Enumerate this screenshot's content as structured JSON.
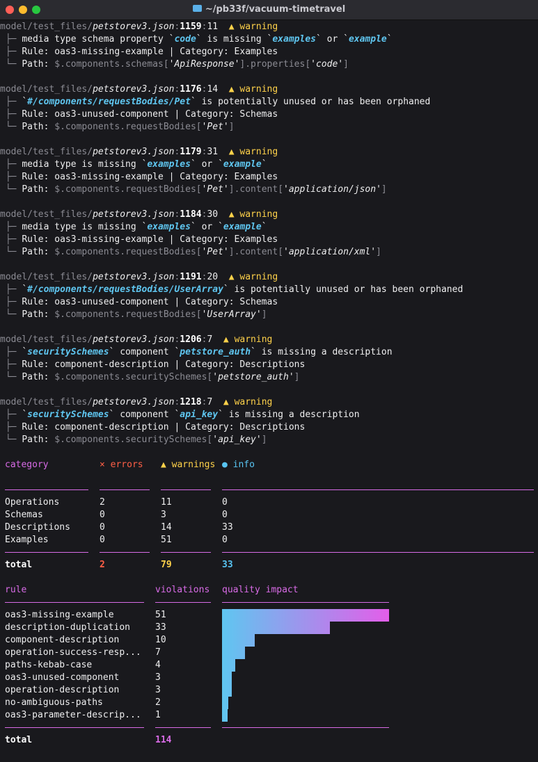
{
  "window": {
    "title": "~/pb33f/vacuum-timetravel"
  },
  "violations": [
    {
      "path_prefix": "model/test_files/",
      "file": "petstorev3.json",
      "line": "1159",
      "col": "11",
      "severity": "warning",
      "msg_parts": [
        "media type schema property `",
        "code",
        "` is missing `",
        "examples",
        "` or `",
        "example",
        "`"
      ],
      "rule_label": "Rule: oas3-missing-example | Category: Examples",
      "path_parts": [
        "$.components.schemas[",
        "'ApiResponse'",
        "].properties[",
        "'code'",
        "]"
      ]
    },
    {
      "path_prefix": "model/test_files/",
      "file": "petstorev3.json",
      "line": "1176",
      "col": "14",
      "severity": "warning",
      "msg_parts": [
        "`",
        "#/components/requestBodies/Pet",
        "` is potentially unused or has been orphaned"
      ],
      "rule_label": "Rule: oas3-unused-component | Category: Schemas",
      "path_parts": [
        "$.components.requestBodies[",
        "'Pet'",
        "]"
      ]
    },
    {
      "path_prefix": "model/test_files/",
      "file": "petstorev3.json",
      "line": "1179",
      "col": "31",
      "severity": "warning",
      "msg_parts": [
        "media type is missing `",
        "examples",
        "` or `",
        "example",
        "`"
      ],
      "rule_label": "Rule: oas3-missing-example | Category: Examples",
      "path_parts": [
        "$.components.requestBodies[",
        "'Pet'",
        "].content[",
        "'application/json'",
        "]"
      ]
    },
    {
      "path_prefix": "model/test_files/",
      "file": "petstorev3.json",
      "line": "1184",
      "col": "30",
      "severity": "warning",
      "msg_parts": [
        "media type is missing `",
        "examples",
        "` or `",
        "example",
        "`"
      ],
      "rule_label": "Rule: oas3-missing-example | Category: Examples",
      "path_parts": [
        "$.components.requestBodies[",
        "'Pet'",
        "].content[",
        "'application/xml'",
        "]"
      ]
    },
    {
      "path_prefix": "model/test_files/",
      "file": "petstorev3.json",
      "line": "1191",
      "col": "20",
      "severity": "warning",
      "msg_parts": [
        "`",
        "#/components/requestBodies/UserArray",
        "` is potentially unused or has been orphaned"
      ],
      "rule_label": "Rule: oas3-unused-component | Category: Schemas",
      "path_parts": [
        "$.components.requestBodies[",
        "'UserArray'",
        "]"
      ]
    },
    {
      "path_prefix": "model/test_files/",
      "file": "petstorev3.json",
      "line": "1206",
      "col": "7",
      "severity": "warning",
      "msg_parts": [
        "`",
        "securitySchemes",
        "` component `",
        "petstore_auth",
        "` is missing a description"
      ],
      "rule_label": "Rule: component-description | Category: Descriptions",
      "path_parts": [
        "$.components.securitySchemes[",
        "'petstore_auth'",
        "]"
      ]
    },
    {
      "path_prefix": "model/test_files/",
      "file": "petstorev3.json",
      "line": "1218",
      "col": "7",
      "severity": "warning",
      "msg_parts": [
        "`",
        "securitySchemes",
        "` component `",
        "api_key",
        "` is missing a description"
      ],
      "rule_label": "Rule: component-description | Category: Descriptions",
      "path_parts": [
        "$.components.securitySchemes[",
        "'api_key'",
        "]"
      ]
    }
  ],
  "category_table": {
    "headers": {
      "category": "category",
      "errors": "errors",
      "warnings": "warnings",
      "info": "info"
    },
    "rows": [
      {
        "name": "Operations",
        "errors": "2",
        "warnings": "11",
        "info": "0"
      },
      {
        "name": "Schemas",
        "errors": "0",
        "warnings": "3",
        "info": "0"
      },
      {
        "name": "Descriptions",
        "errors": "0",
        "warnings": "14",
        "info": "33"
      },
      {
        "name": "Examples",
        "errors": "0",
        "warnings": "51",
        "info": "0"
      }
    ],
    "total": {
      "label": "total",
      "errors": "2",
      "warnings": "79",
      "info": "33"
    }
  },
  "rule_table": {
    "headers": {
      "rule": "rule",
      "violations": "violations",
      "impact": "quality impact"
    },
    "rows": [
      {
        "rule": "oas3-missing-example",
        "violations": 51
      },
      {
        "rule": "description-duplication",
        "violations": 33
      },
      {
        "rule": "component-description",
        "violations": 10
      },
      {
        "rule": "operation-success-resp...",
        "violations": 7
      },
      {
        "rule": "paths-kebab-case",
        "violations": 4
      },
      {
        "rule": "oas3-unused-component",
        "violations": 3
      },
      {
        "rule": "operation-description",
        "violations": 3
      },
      {
        "rule": "no-ambiguous-paths",
        "violations": 2
      },
      {
        "rule": "oas3-parameter-descrip...",
        "violations": 1
      }
    ],
    "total": {
      "label": "total",
      "violations": "114"
    }
  },
  "colors": {
    "warning": "#ffd24a",
    "error": "#ff5f46",
    "info": "#58c4f2",
    "accent": "#d86be6",
    "bar_start": "#5fc6f0",
    "bar_end": "#e35ee9"
  }
}
